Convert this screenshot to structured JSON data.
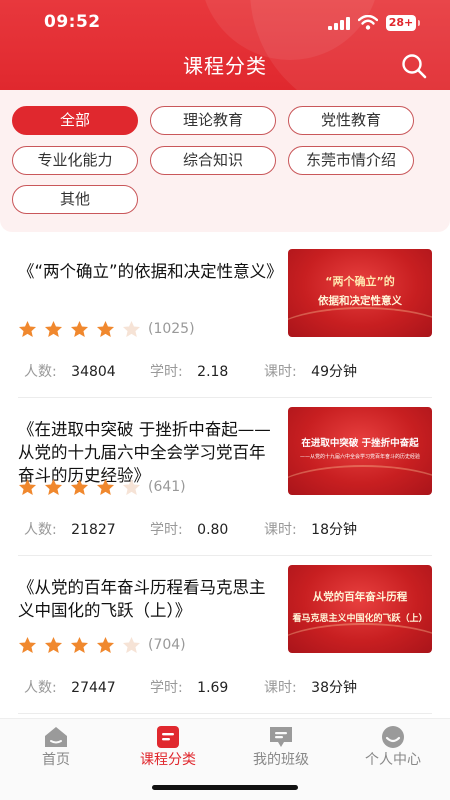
{
  "status": {
    "time": "09:52",
    "battery": "28+"
  },
  "header": {
    "title": "课程分类"
  },
  "filters": [
    {
      "label": "全部",
      "active": true
    },
    {
      "label": "理论教育",
      "active": false
    },
    {
      "label": "党性教育",
      "active": false
    },
    {
      "label": "专业化能力",
      "active": false
    },
    {
      "label": "综合知识",
      "active": false
    },
    {
      "label": "东莞市情介绍",
      "active": false
    },
    {
      "label": "其他",
      "active": false
    }
  ],
  "meta_labels": {
    "people": "人数:",
    "credits": "学时:",
    "duration": "课时:"
  },
  "courses": [
    {
      "title": "《“两个确立”的依据和决定性意义》",
      "thumb_lines": [
        "“两个确立”的",
        "依据和决定性意义"
      ],
      "stars": 4,
      "rating_count": "(1025)",
      "people": "34804",
      "credits": "2.18",
      "duration": "49分钟"
    },
    {
      "title": "《在进取中突破 于挫折中奋起——从党的十九届六中全会学习党百年奋斗的历史经验》",
      "thumb_lines": [
        "在进取中突破 于挫折中奋起",
        "——从党的十九届六中全会学习党百年奋斗的历史经验"
      ],
      "stars": 4,
      "rating_count": "(641)",
      "people": "21827",
      "credits": "0.80",
      "duration": "18分钟"
    },
    {
      "title": "《从党的百年奋斗历程看马克思主义中国化的飞跃（上）》",
      "thumb_lines": [
        "从党的百年奋斗历程",
        "看马克思主义中国化的飞跃（上）"
      ],
      "stars": 4,
      "rating_count": "(704)",
      "people": "27447",
      "credits": "1.69",
      "duration": "38分钟"
    }
  ],
  "tabbar": [
    {
      "label": "首页",
      "icon": "home-icon",
      "active": false
    },
    {
      "label": "课程分类",
      "icon": "course-category-icon",
      "active": true
    },
    {
      "label": "我的班级",
      "icon": "class-icon",
      "active": false
    },
    {
      "label": "个人中心",
      "icon": "profile-icon",
      "active": false
    }
  ],
  "colors": {
    "brand": "#e0282e",
    "star": "#f0882e",
    "star_empty": "#f6e3d6",
    "panel_bg": "#fdf1f1"
  }
}
